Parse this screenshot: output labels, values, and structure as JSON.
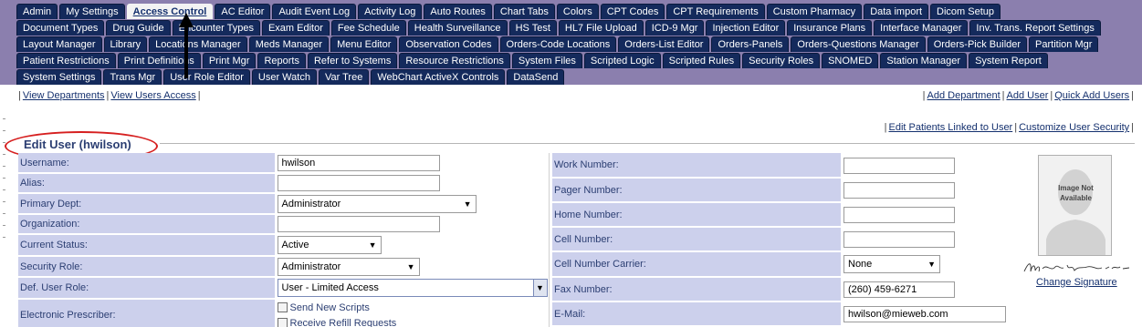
{
  "tabs": {
    "row1": [
      "Admin",
      "My Settings",
      "Access Control",
      "AC Editor",
      "Audit Event Log",
      "Activity Log",
      "Auto Routes",
      "Chart Tabs",
      "Colors",
      "CPT Codes",
      "CPT Requirements",
      "Custom Pharmacy",
      "Data import",
      "Dicom Setup"
    ],
    "row2": [
      "Document Types",
      "Drug Guide",
      "Encounter Types",
      "Exam Editor",
      "Fee Schedule",
      "Health Surveillance",
      "HS Test",
      "HL7 File Upload",
      "ICD-9 Mgr",
      "Injection Editor",
      "Insurance Plans",
      "Interface Manager",
      "Inv. Trans. Report Settings"
    ],
    "row3": [
      "Layout Manager",
      "Library",
      "Locations Manager",
      "Meds Manager",
      "Menu Editor",
      "Observation Codes",
      "Orders-Code Locations",
      "Orders-List Editor",
      "Orders-Panels",
      "Orders-Questions Manager",
      "Orders-Pick Builder",
      "Partition Mgr"
    ],
    "row4": [
      "Patient Restrictions",
      "Print Definitions",
      "Print Mgr",
      "Reports",
      "Refer to Systems",
      "Resource Restrictions",
      "System Files",
      "Scripted Logic",
      "Scripted Rules",
      "Security Roles",
      "SNOMED",
      "Station Manager",
      "System Report"
    ],
    "row5": [
      "System Settings",
      "Trans Mgr",
      "User Role Editor",
      "User Watch",
      "Var Tree",
      "WebChart ActiveX Controls",
      "DataSend"
    ],
    "active": "Access Control"
  },
  "links": {
    "left": [
      "View Departments",
      "View Users Access"
    ],
    "right": [
      "Add Department",
      "Add User",
      "Quick Add Users"
    ],
    "right2": [
      "Edit Patients Linked to User",
      "Customize User Security"
    ]
  },
  "section": {
    "title": "Edit User (hwilson)"
  },
  "left_form": {
    "username_label": "Username:",
    "username_value": "hwilson",
    "alias_label": "Alias:",
    "alias_value": "",
    "primary_dept_label": "Primary Dept:",
    "primary_dept_value": "Administrator",
    "organization_label": "Organization:",
    "organization_value": "",
    "current_status_label": "Current Status:",
    "current_status_value": "Active",
    "security_role_label": "Security Role:",
    "security_role_value": "Administrator",
    "def_user_role_label": "Def. User Role:",
    "def_user_role_value": "User - Limited Access",
    "electronic_prescriber_label": "Electronic Prescriber:",
    "send_new_scripts_label": "Send New Scripts",
    "receive_refill_label": "Receive Refill Requests"
  },
  "right_form": {
    "work_number_label": "Work Number:",
    "work_number_value": "",
    "pager_number_label": "Pager Number:",
    "pager_number_value": "",
    "home_number_label": "Home Number:",
    "home_number_value": "",
    "cell_number_label": "Cell Number:",
    "cell_number_value": "",
    "cell_carrier_label": "Cell Number Carrier:",
    "cell_carrier_value": "None",
    "fax_number_label": "Fax Number:",
    "fax_number_value": "(260) 459-6271",
    "email_label": "E-Mail:",
    "email_value": "hwilson@mieweb.com"
  },
  "photo": {
    "text_line1": "Image Not",
    "text_line2": "Available"
  },
  "signature": {
    "change_label": "Change Signature"
  },
  "colors": {
    "tab_band": "#8b7fae",
    "tab": "#142a5c",
    "label_bg": "#ccd0ec",
    "title": "#2b3e72",
    "highlight_oval": "#d61f1f"
  }
}
